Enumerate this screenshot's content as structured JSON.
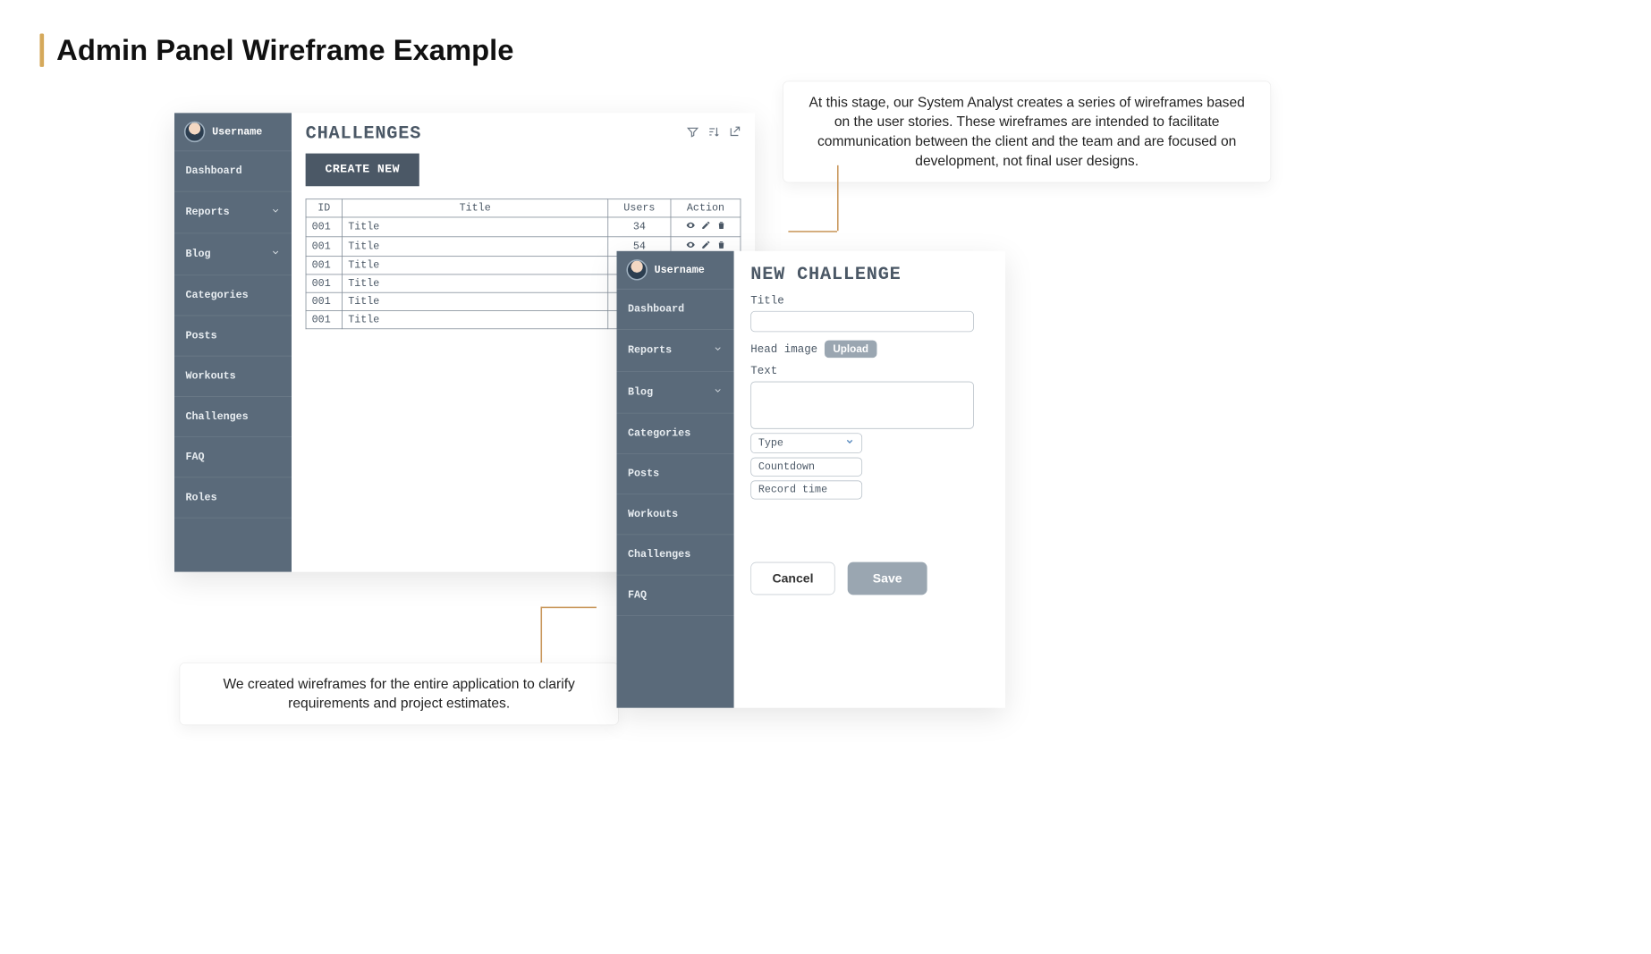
{
  "heading": "Admin Panel Wireframe Example",
  "callouts": {
    "top": "At this stage, our System Analyst creates a series of wireframes based on the user stories. These wireframes are intended to facilitate communication between the client and the team and are focused on development, not final user designs.",
    "bottom": "We created wireframes for the entire application to clarify requirements and project estimates."
  },
  "sidebar": {
    "username": "Username",
    "items": [
      {
        "label": "Dashboard",
        "expandable": false
      },
      {
        "label": "Reports",
        "expandable": true
      },
      {
        "label": "Blog",
        "expandable": true
      },
      {
        "label": "Categories",
        "expandable": false
      },
      {
        "label": "Posts",
        "expandable": false
      },
      {
        "label": "Workouts",
        "expandable": false
      },
      {
        "label": "Challenges",
        "expandable": false
      },
      {
        "label": "FAQ",
        "expandable": false
      },
      {
        "label": "Roles",
        "expandable": false
      }
    ]
  },
  "challenges": {
    "title": "CHALLENGES",
    "create_label": "CREATE NEW",
    "columns": {
      "id": "ID",
      "title": "Title",
      "users": "Users",
      "action": "Action"
    },
    "rows": [
      {
        "id": "001",
        "title": "Title",
        "users": "34"
      },
      {
        "id": "001",
        "title": "Title",
        "users": "54"
      },
      {
        "id": "001",
        "title": "Title",
        "users": ""
      },
      {
        "id": "001",
        "title": "Title",
        "users": ""
      },
      {
        "id": "001",
        "title": "Title",
        "users": ""
      },
      {
        "id": "001",
        "title": "Title",
        "users": ""
      }
    ]
  },
  "form": {
    "title": "NEW CHALLENGE",
    "labels": {
      "title": "Title",
      "head_image": "Head image",
      "upload": "Upload",
      "text": "Text",
      "type": "Type",
      "countdown": "Countdown",
      "record_time": "Record time"
    },
    "buttons": {
      "cancel": "Cancel",
      "save": "Save"
    }
  }
}
